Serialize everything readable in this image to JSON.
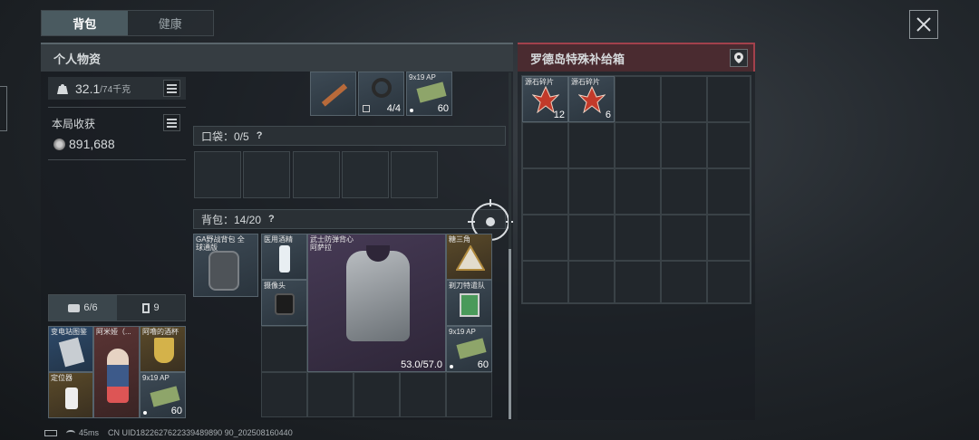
{
  "top_tabs": [
    {
      "label": "背包"
    },
    {
      "label": "健康"
    }
  ],
  "left_panel": {
    "title": "个人物资",
    "weight": {
      "value": "32.1",
      "max": "/74千克"
    },
    "earnings": {
      "label": "本局收获",
      "value": "891,688"
    },
    "small_tabs": [
      {
        "label": "6/6"
      },
      {
        "label": "9"
      }
    ]
  },
  "right_panel": {
    "title": "罗德岛特殊补给箱"
  },
  "pockets": {
    "label": "口袋：0/5"
  },
  "backpack": {
    "label": "背包：14/20"
  },
  "top_items": [
    {
      "name": "",
      "count": ""
    },
    {
      "name": "",
      "count": "4/4"
    },
    {
      "name": "9x19 AP",
      "count": "60"
    }
  ],
  "backpack_slot": {
    "name": "GA野战背包 全球通版"
  },
  "backpack_items": [
    {
      "name": "医用酒精",
      "count": ""
    },
    {
      "name": "武士防弹背心 阿萨拉",
      "count": "53.0/57.0"
    },
    {
      "name": "糖三角",
      "count": ""
    },
    {
      "name": "摄像头",
      "count": ""
    },
    {
      "name": "剃刀特遣队",
      "count": ""
    },
    {
      "name": "9x19 AP",
      "count": "60"
    }
  ],
  "quick_items": [
    {
      "name": "变电站图鉴"
    },
    {
      "name": "阿米娅（..."
    },
    {
      "name": "阿噜的酒杯"
    },
    {
      "name": "定位器"
    },
    {
      "name": "9x19 AP",
      "count": "60"
    }
  ],
  "crate_items": [
    {
      "name": "源石碎片",
      "count": "12"
    },
    {
      "name": "源石碎片",
      "count": "6"
    }
  ],
  "status_bar": {
    "ping": "45ms",
    "uid": "CN UID1822627622339489890 90_202508160440"
  }
}
